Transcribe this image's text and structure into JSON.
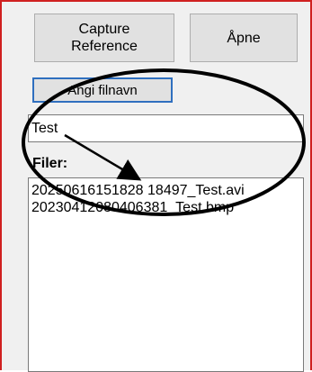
{
  "buttons": {
    "capture_line1": "Capture",
    "capture_line2": "Reference",
    "open": "Åpne",
    "set_filename": "Angi filnavn"
  },
  "filename_input": {
    "value": "Test"
  },
  "files_label": "Filer:",
  "files": [
    "20250616151828 18497_Test.avi",
    "20230412080406381_Test.bmp"
  ],
  "colors": {
    "frame_border": "#d02020",
    "annotation": "#000000",
    "focus_border": "#2f6fbf"
  },
  "annotation": {
    "ellipse": "annotation-ellipse",
    "arrow": "annotation-arrow"
  }
}
